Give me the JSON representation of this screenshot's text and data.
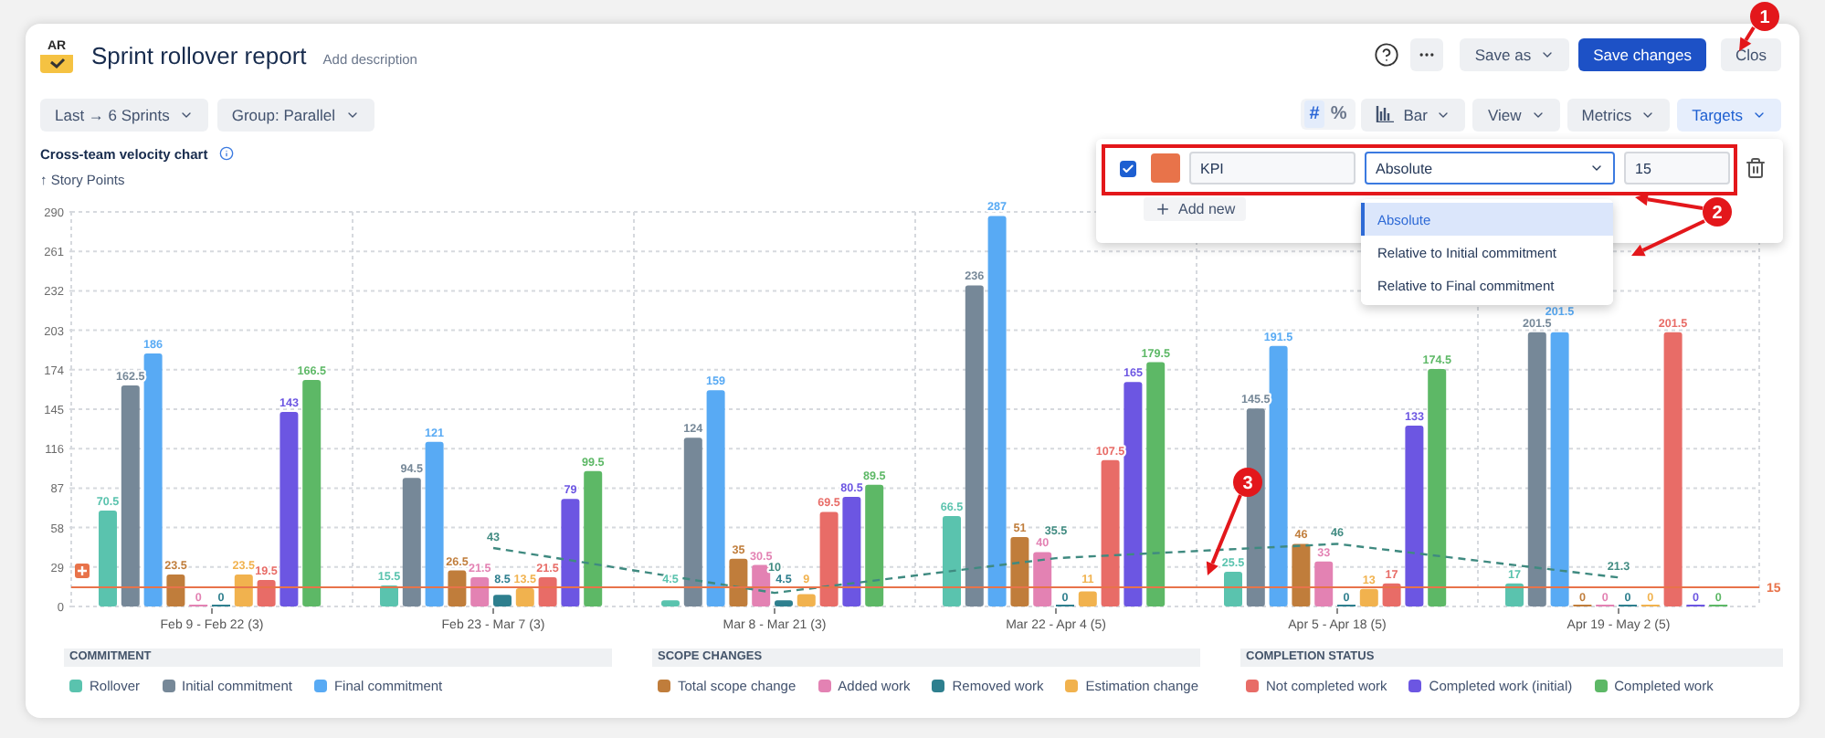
{
  "report": {
    "logo": "AR",
    "title": "Sprint rollover report",
    "description_link": "Add description"
  },
  "header_buttons": [
    {
      "label": "Save as",
      "kind": "dropdown"
    },
    {
      "label": "Save changes",
      "kind": "primary"
    },
    {
      "label": "Clos",
      "kind": "plain"
    }
  ],
  "filters": [
    {
      "label": "Last → 6 Sprints"
    },
    {
      "label": "Group: Parallel"
    }
  ],
  "number_toggle": [
    {
      "label": "#",
      "selected": true
    },
    {
      "label": "%",
      "selected": false
    }
  ],
  "menus": [
    {
      "label": "Bar",
      "kind": "chart-type",
      "selected": false
    },
    {
      "label": "View",
      "kind": "menu",
      "selected": false
    },
    {
      "label": "Metrics",
      "kind": "menu",
      "selected": false
    },
    {
      "label": "Targets",
      "kind": "menu",
      "selected": true
    }
  ],
  "chart": {
    "title": "Cross-team velocity chart",
    "chart_data": {
      "type": "bar",
      "stacked": false,
      "grid": true,
      "ylabel": "↑ Story Points",
      "ylim": [
        0,
        290
      ],
      "yticks": [
        0,
        29,
        58,
        87,
        116,
        145,
        174,
        203,
        232,
        261,
        290
      ],
      "data_labels": true,
      "categories": [
        "Feb 9 - Feb 22 (3)",
        "Feb 23 - Mar 7 (3)",
        "Mar 8 - Mar 21 (3)",
        "Mar 22 - Apr 4 (5)",
        "Apr 5 - Apr 18 (5)",
        "Apr 19 - May 2 (5)"
      ],
      "series": [
        {
          "name": "Rollover",
          "color": "#5ac3ae",
          "values": [
            70.5,
            15.5,
            4.5,
            66.5,
            25.5,
            17
          ]
        },
        {
          "name": "Initial commitment",
          "color": "#768898",
          "values": [
            162.5,
            94.5,
            124,
            236,
            145.5,
            201.5
          ]
        },
        {
          "name": "Final commitment",
          "color": "#58aaf4",
          "values": [
            186,
            121,
            159,
            287,
            191.5,
            201.5
          ]
        },
        {
          "name": "Total scope change",
          "color": "#c07d3b",
          "values": [
            23.5,
            26.5,
            35,
            51,
            46,
            0
          ]
        },
        {
          "name": "Added work",
          "color": "#e382b3",
          "values": [
            0,
            21.5,
            30.5,
            40,
            33,
            0
          ]
        },
        {
          "name": "Removed work",
          "color": "#2e7f8e",
          "values": [
            0,
            8.5,
            4.5,
            0,
            0,
            0
          ]
        },
        {
          "name": "Estimation change",
          "color": "#f1b24e",
          "values": [
            23.5,
            13.5,
            9,
            11,
            13,
            0
          ]
        },
        {
          "name": "Not completed work",
          "color": "#e86c67",
          "values": [
            19.5,
            21.5,
            69.5,
            107.5,
            17,
            201.5
          ]
        },
        {
          "name": "Completed work (initial)",
          "color": "#6c56e2",
          "values": [
            143,
            79,
            80.5,
            165,
            133,
            0
          ]
        },
        {
          "name": "Completed work",
          "color": "#5db866",
          "values": [
            166.5,
            99.5,
            89.5,
            179.5,
            174.5,
            0
          ]
        },
        {
          "type": "line",
          "line_style": "dashed",
          "color": "#3f8a80",
          "values": [
            null,
            43,
            10,
            35.5,
            46,
            21.3
          ]
        }
      ],
      "ref_lines": [
        {
          "axis": "y",
          "value": 15,
          "label": "15"
        }
      ]
    }
  },
  "targets_popover": {
    "rows": [
      {
        "checked": true,
        "color": "#e8734a",
        "name": "KPI",
        "mode": "Absolute",
        "value": "15"
      }
    ],
    "add_button": "Add new"
  },
  "mode_menu": [
    {
      "label": "Absolute",
      "selected": true
    },
    {
      "label": "Relative to Initial commitment",
      "selected": false
    },
    {
      "label": "Relative to Final commitment",
      "selected": false
    }
  ],
  "legend": [
    {
      "title": "COMMITMENT"
    },
    {
      "title": "SCOPE CHANGES"
    },
    {
      "title": "COMPLETION STATUS"
    }
  ],
  "callouts": [
    {
      "label": "1"
    },
    {
      "label": "2"
    },
    {
      "label": "3"
    }
  ]
}
